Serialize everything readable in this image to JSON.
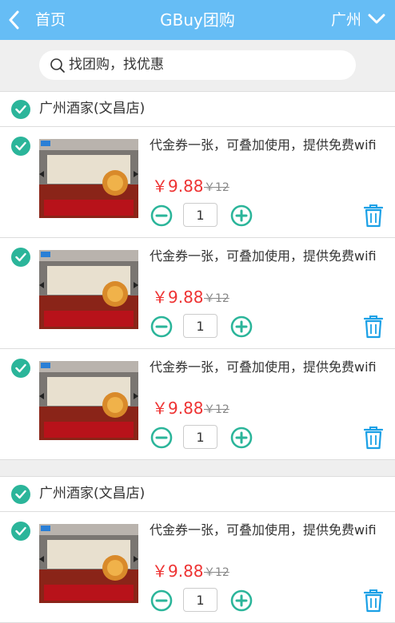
{
  "header": {
    "back_label": "首页",
    "title": "GBuy团购",
    "city": "广州"
  },
  "search": {
    "placeholder": "找团购，找优惠"
  },
  "colors": {
    "accent": "#66bdf5",
    "check": "#2bb59a",
    "price": "#ee3333",
    "trash": "#1aa0e6"
  },
  "groups": [
    {
      "shop_name": "广州酒家(文昌店)",
      "items": [
        {
          "title": "代金券一张，可叠加使用，提供免费wifi",
          "price": "￥9.88",
          "old_price": "￥12",
          "qty": "1"
        },
        {
          "title": "代金券一张，可叠加使用，提供免费wifi",
          "price": "￥9.88",
          "old_price": "￥12",
          "qty": "1"
        },
        {
          "title": "代金券一张，可叠加使用，提供免费wifi",
          "price": "￥9.88",
          "old_price": "￥12",
          "qty": "1"
        }
      ]
    },
    {
      "shop_name": "广州酒家(文昌店)",
      "items": [
        {
          "title": "代金券一张，可叠加使用，提供免费wifi",
          "price": "￥9.88",
          "old_price": "￥12",
          "qty": "1"
        }
      ]
    }
  ]
}
